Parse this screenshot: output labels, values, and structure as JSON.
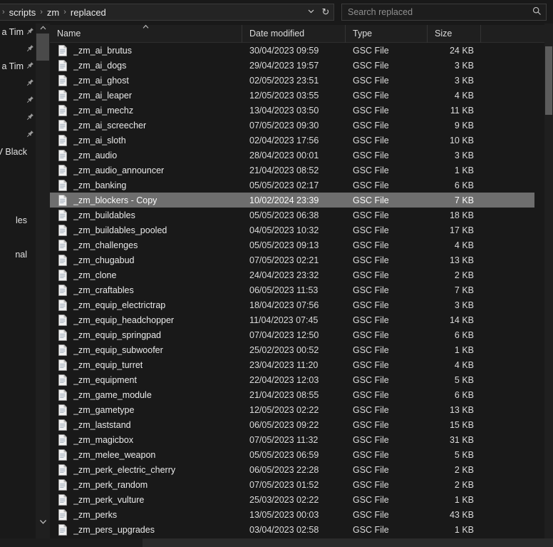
{
  "window": {
    "title": "replaced"
  },
  "address_bar": {
    "breadcrumbs": [
      "scripts",
      "zm",
      "replaced"
    ],
    "separator": "›",
    "leading_separator": "›",
    "dropdown_icon": "chevron-down-icon",
    "refresh_icon": "refresh-icon",
    "refresh_glyph": "↻",
    "chevron_glyph": "⌄"
  },
  "search": {
    "placeholder": "Search replaced",
    "value": "",
    "icon": "search-icon",
    "icon_glyph": "⌕"
  },
  "columns": {
    "name": "Name",
    "date_modified": "Date modified",
    "type": "Type",
    "size": "Size",
    "sort_column": "Name",
    "sort_direction": "ascending",
    "sort_caret_glyph": "˄"
  },
  "left_panel": {
    "rows": [
      {
        "text": "a Tim",
        "pin": true
      },
      {
        "text": "",
        "pin": true
      },
      {
        "text": "a Tim",
        "pin": true
      },
      {
        "text": "",
        "pin": true
      },
      {
        "text": "",
        "pin": true
      },
      {
        "text": "",
        "pin": true
      },
      {
        "text": "",
        "pin": true
      },
      {
        "text": "d IV  Black",
        "pin": false
      },
      {
        "text": "",
        "pin": false
      },
      {
        "text": "",
        "pin": false
      },
      {
        "text": "",
        "pin": false
      },
      {
        "text": "les",
        "pin": false
      },
      {
        "text": "",
        "pin": false
      },
      {
        "text": "nal",
        "pin": false
      }
    ],
    "pin_glyph": "📌"
  },
  "left_strip": {
    "scroll_up_icon": "chevron-up-icon",
    "scroll_down_icon": "chevron-down-icon",
    "up_glyph": "˄",
    "down_glyph": "˅"
  },
  "scrollbar": {
    "vertical_position": "near-top",
    "name": "vertical-scrollbar"
  },
  "files": [
    {
      "name": "_zm_ai_brutus",
      "date": "30/04/2023 09:59",
      "type": "GSC File",
      "size": "24 KB",
      "selected": false
    },
    {
      "name": "_zm_ai_dogs",
      "date": "29/04/2023 19:57",
      "type": "GSC File",
      "size": "3 KB",
      "selected": false
    },
    {
      "name": "_zm_ai_ghost",
      "date": "02/05/2023 23:51",
      "type": "GSC File",
      "size": "3 KB",
      "selected": false
    },
    {
      "name": "_zm_ai_leaper",
      "date": "12/05/2023 03:55",
      "type": "GSC File",
      "size": "4 KB",
      "selected": false
    },
    {
      "name": "_zm_ai_mechz",
      "date": "13/04/2023 03:50",
      "type": "GSC File",
      "size": "11 KB",
      "selected": false
    },
    {
      "name": "_zm_ai_screecher",
      "date": "07/05/2023 09:30",
      "type": "GSC File",
      "size": "9 KB",
      "selected": false
    },
    {
      "name": "_zm_ai_sloth",
      "date": "02/04/2023 17:56",
      "type": "GSC File",
      "size": "10 KB",
      "selected": false
    },
    {
      "name": "_zm_audio",
      "date": "28/04/2023 00:01",
      "type": "GSC File",
      "size": "3 KB",
      "selected": false
    },
    {
      "name": "_zm_audio_announcer",
      "date": "21/04/2023 08:52",
      "type": "GSC File",
      "size": "1 KB",
      "selected": false
    },
    {
      "name": "_zm_banking",
      "date": "05/05/2023 02:17",
      "type": "GSC File",
      "size": "6 KB",
      "selected": false
    },
    {
      "name": "_zm_blockers - Copy",
      "date": "10/02/2024 23:39",
      "type": "GSC File",
      "size": "7 KB",
      "selected": true
    },
    {
      "name": "_zm_buildables",
      "date": "05/05/2023 06:38",
      "type": "GSC File",
      "size": "18 KB",
      "selected": false
    },
    {
      "name": "_zm_buildables_pooled",
      "date": "04/05/2023 10:32",
      "type": "GSC File",
      "size": "17 KB",
      "selected": false
    },
    {
      "name": "_zm_challenges",
      "date": "05/05/2023 09:13",
      "type": "GSC File",
      "size": "4 KB",
      "selected": false
    },
    {
      "name": "_zm_chugabud",
      "date": "07/05/2023 02:21",
      "type": "GSC File",
      "size": "13 KB",
      "selected": false
    },
    {
      "name": "_zm_clone",
      "date": "24/04/2023 23:32",
      "type": "GSC File",
      "size": "2 KB",
      "selected": false
    },
    {
      "name": "_zm_craftables",
      "date": "06/05/2023 11:53",
      "type": "GSC File",
      "size": "7 KB",
      "selected": false
    },
    {
      "name": "_zm_equip_electrictrap",
      "date": "18/04/2023 07:56",
      "type": "GSC File",
      "size": "3 KB",
      "selected": false
    },
    {
      "name": "_zm_equip_headchopper",
      "date": "11/04/2023 07:45",
      "type": "GSC File",
      "size": "14 KB",
      "selected": false
    },
    {
      "name": "_zm_equip_springpad",
      "date": "07/04/2023 12:50",
      "type": "GSC File",
      "size": "6 KB",
      "selected": false
    },
    {
      "name": "_zm_equip_subwoofer",
      "date": "25/02/2023 00:52",
      "type": "GSC File",
      "size": "1 KB",
      "selected": false
    },
    {
      "name": "_zm_equip_turret",
      "date": "23/04/2023 11:20",
      "type": "GSC File",
      "size": "4 KB",
      "selected": false
    },
    {
      "name": "_zm_equipment",
      "date": "22/04/2023 12:03",
      "type": "GSC File",
      "size": "5 KB",
      "selected": false
    },
    {
      "name": "_zm_game_module",
      "date": "21/04/2023 08:55",
      "type": "GSC File",
      "size": "6 KB",
      "selected": false
    },
    {
      "name": "_zm_gametype",
      "date": "12/05/2023 02:22",
      "type": "GSC File",
      "size": "13 KB",
      "selected": false
    },
    {
      "name": "_zm_laststand",
      "date": "06/05/2023 09:22",
      "type": "GSC File",
      "size": "15 KB",
      "selected": false
    },
    {
      "name": "_zm_magicbox",
      "date": "07/05/2023 11:32",
      "type": "GSC File",
      "size": "31 KB",
      "selected": false
    },
    {
      "name": "_zm_melee_weapon",
      "date": "05/05/2023 06:59",
      "type": "GSC File",
      "size": "5 KB",
      "selected": false
    },
    {
      "name": "_zm_perk_electric_cherry",
      "date": "06/05/2023 22:28",
      "type": "GSC File",
      "size": "2 KB",
      "selected": false
    },
    {
      "name": "_zm_perk_random",
      "date": "07/05/2023 01:52",
      "type": "GSC File",
      "size": "2 KB",
      "selected": false
    },
    {
      "name": "_zm_perk_vulture",
      "date": "25/03/2023 02:22",
      "type": "GSC File",
      "size": "1 KB",
      "selected": false
    },
    {
      "name": "_zm_perks",
      "date": "13/05/2023 00:03",
      "type": "GSC File",
      "size": "43 KB",
      "selected": false
    },
    {
      "name": "_zm_pers_upgrades",
      "date": "03/04/2023 02:58",
      "type": "GSC File",
      "size": "1 KB",
      "selected": false
    }
  ],
  "colors": {
    "background": "#191919",
    "selection": "#6e6e6e",
    "text": "#eaeaea",
    "muted_text": "#8f8f8f",
    "border": "#3a3a3a"
  }
}
